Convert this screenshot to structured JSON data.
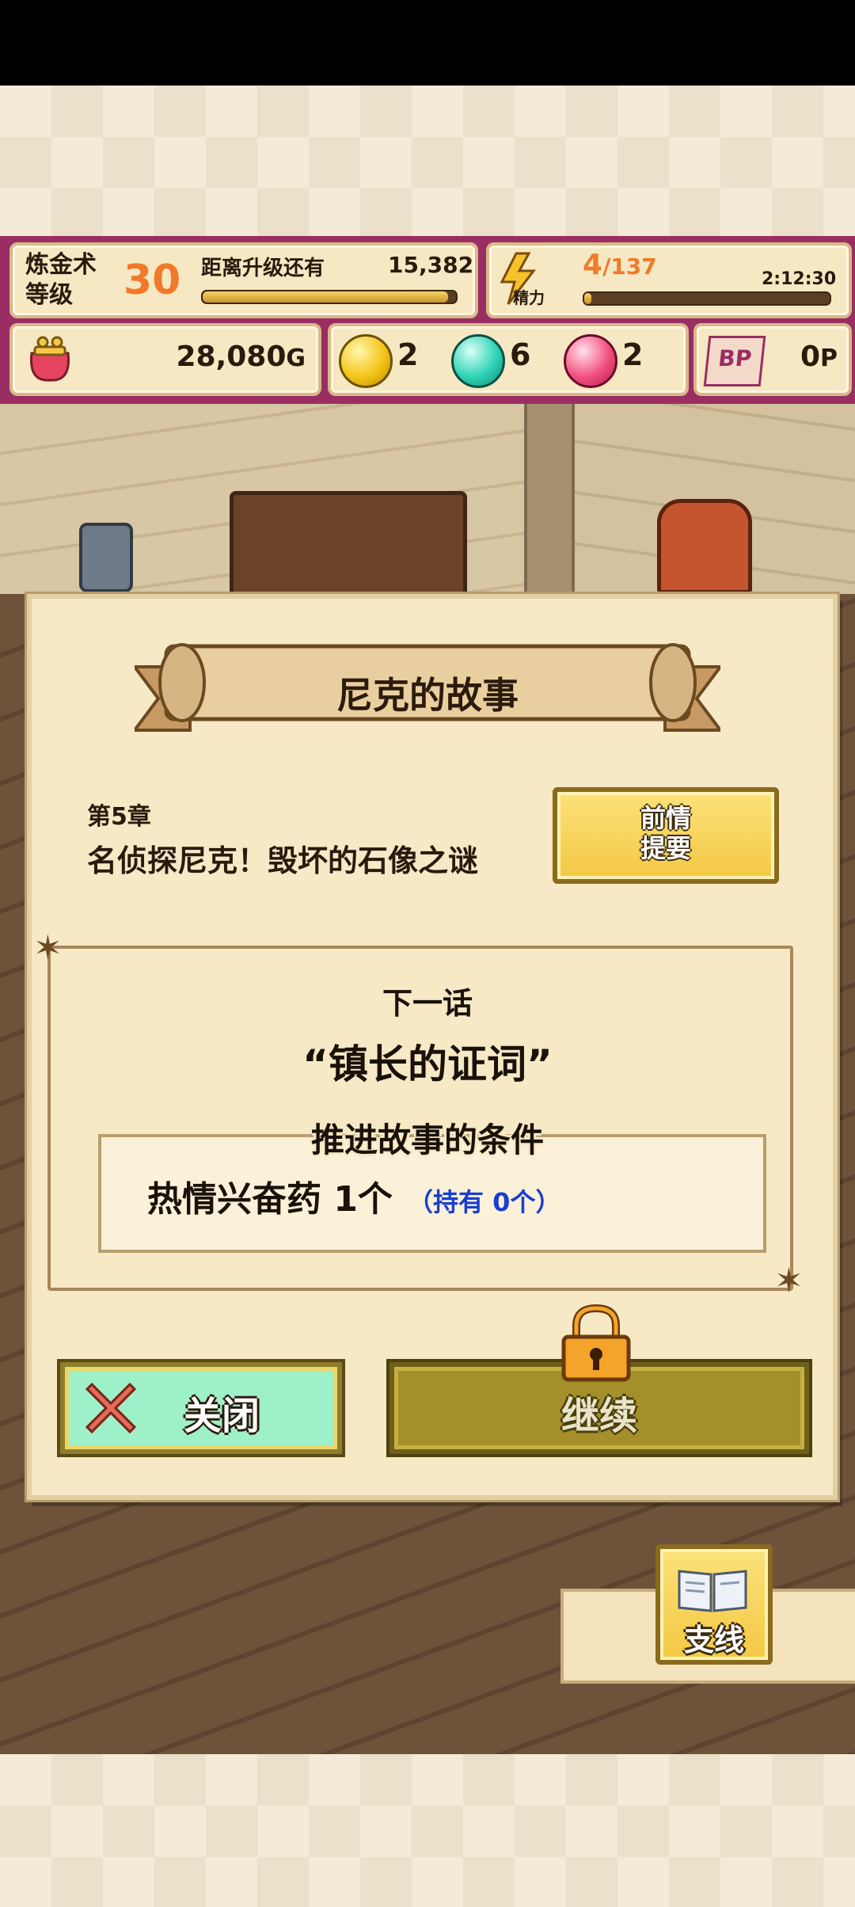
{
  "hud": {
    "alchemy_label_1": "炼金术",
    "alchemy_label_2": "等级",
    "level": "30",
    "next_level_label": "距离升级还有",
    "next_level_value": "15,382",
    "level_progress": 0.97,
    "energy_value": "4",
    "energy_max": "/137",
    "energy_label": "精力",
    "energy_timer": "2:12:30",
    "energy_progress": 0.03,
    "gold": "28,080",
    "gold_unit": "G",
    "gem_yellow": "2",
    "gem_cyan": "6",
    "gem_pink": "2",
    "bp_icon_text": "BP",
    "bp_value": "0",
    "bp_unit": "P"
  },
  "dialog": {
    "title": "尼克的故事",
    "chapter": "第5章",
    "chapter_title": "名侦探尼克！毁坏的石像之谜",
    "summary_button_line1": "前情",
    "summary_button_line2": "提要",
    "next_episode_label": "下一话",
    "next_episode_title": "“镇长的证词”",
    "condition_title": "推进故事的条件",
    "condition_item": "热情兴奋药 1个",
    "condition_owned": "（持有 0个）",
    "close_label": "关闭",
    "continue_label": "继续"
  },
  "side_branch": {
    "label": "支线"
  },
  "colors": {
    "hud_border": "#9a2e63",
    "level_number": "#f07a2a",
    "owned_text": "#1a3fcf"
  }
}
